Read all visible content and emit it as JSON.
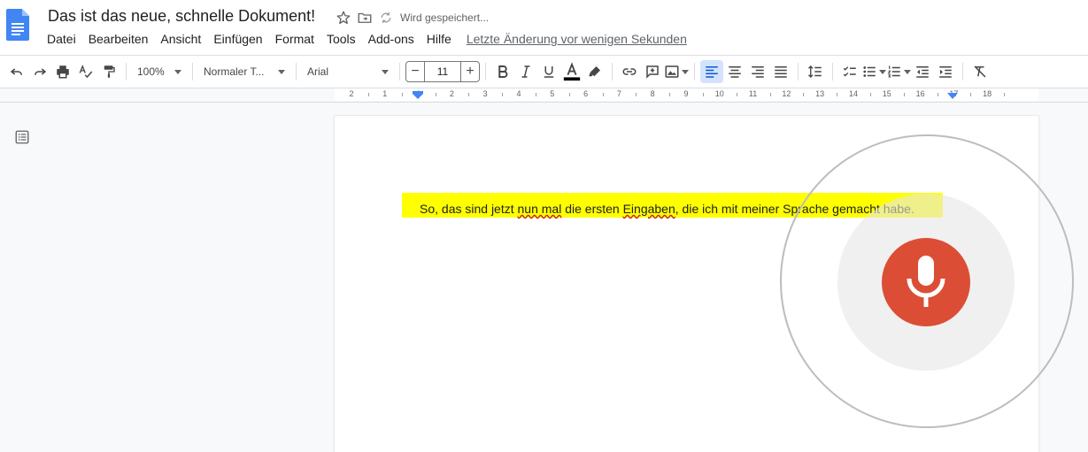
{
  "header": {
    "doc_title": "Das ist das neue, schnelle Dokument!",
    "saving_status": "Wird gespeichert..."
  },
  "menu": {
    "items": [
      "Datei",
      "Bearbeiten",
      "Ansicht",
      "Einfügen",
      "Format",
      "Tools",
      "Add-ons",
      "Hilfe"
    ],
    "last_edit": "Letzte Änderung vor wenigen Sekunden"
  },
  "toolbar": {
    "zoom": "100%",
    "style": "Normaler T...",
    "font": "Arial",
    "font_size": "11",
    "minus": "−",
    "plus": "+"
  },
  "ruler": {
    "labels": [
      "2",
      "1",
      "1",
      "2",
      "3",
      "4",
      "5",
      "6",
      "7",
      "8",
      "9",
      "10",
      "11",
      "12",
      "13",
      "14",
      "15",
      "16",
      "17",
      "18"
    ]
  },
  "document": {
    "text_parts": [
      "So, das sind jetzt ",
      "nun mal",
      " die ersten ",
      "Eingaben",
      ", die ich mit meiner Sprache gemacht habe."
    ],
    "highlight_color": "#ffff00"
  },
  "voice_typing": {
    "mic_color": "#db4e35",
    "icon": "microphone-icon"
  },
  "colors": {
    "accent_blue": "#4285f4",
    "text_color_bar": "#000000"
  }
}
